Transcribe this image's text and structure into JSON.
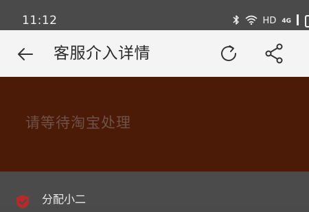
{
  "status_bar": {
    "time": "11:12",
    "icons": [
      "bluetooth-icon",
      "wifi-icon",
      "hd-icon",
      "4g-icon",
      "battery-icon"
    ],
    "hd_label": "HD",
    "net_label": "4G"
  },
  "header": {
    "title": "客服介入详情",
    "back_icon": "back-arrow-icon",
    "refresh_icon": "refresh-icon",
    "share_icon": "share-icon",
    "background": "#f4f4f4"
  },
  "banner": {
    "message": "请等待淘宝处理",
    "background": "#4b1b07"
  },
  "progress": {
    "step_label": "分配小二",
    "step_icon": "check-shield-icon",
    "step_icon_color": "#b52b2b"
  }
}
